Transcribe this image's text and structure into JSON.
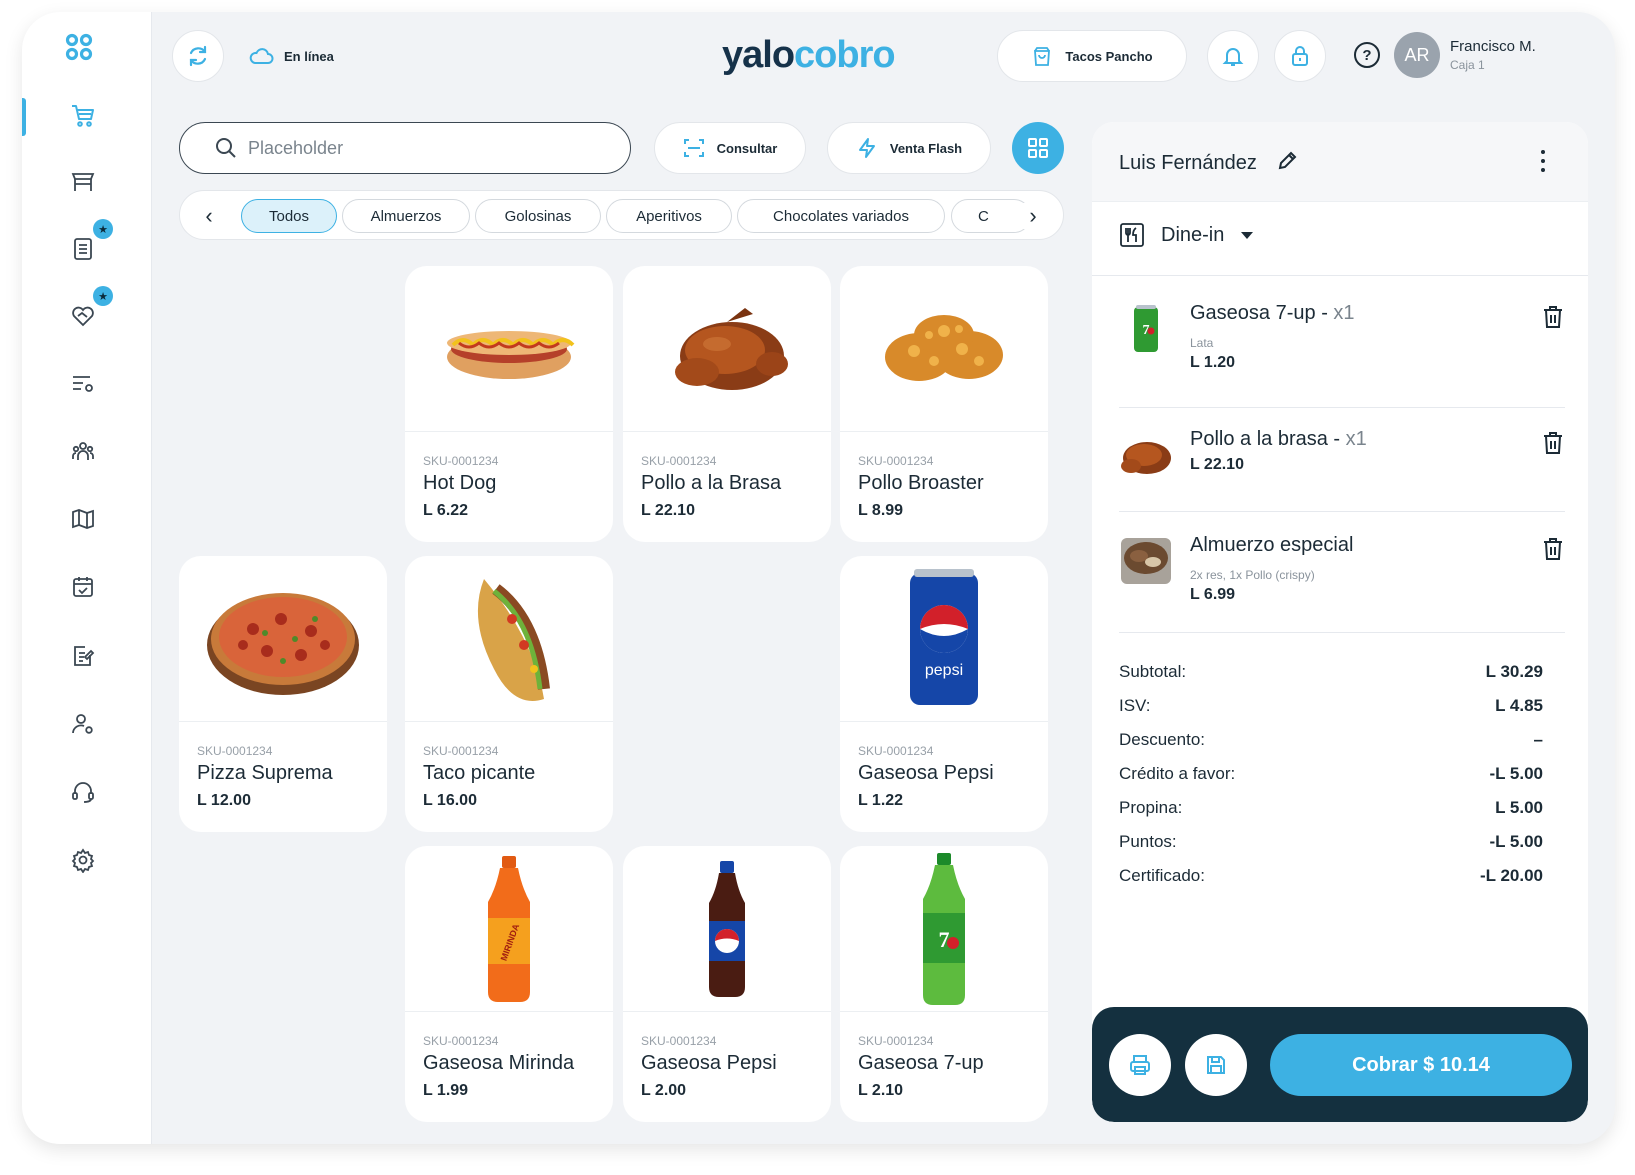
{
  "header": {
    "status_label": "En línea",
    "brand_part1": "yalo",
    "brand_part2": "cobro",
    "store_name": "Tacos Pancho",
    "help_symbol": "?",
    "user_initials": "AR",
    "user_name": "Francisco M.",
    "user_role": "Caja 1"
  },
  "search": {
    "placeholder": "Placeholder",
    "value": ""
  },
  "actions": {
    "consult_label": "Consultar",
    "flash_label": "Venta Flash"
  },
  "categories": [
    "Todos",
    "Almuerzos",
    "Golosinas",
    "Aperitivos",
    "Chocolates variados",
    "C"
  ],
  "active_category": "Todos",
  "products": [
    {
      "sku": "SKU-0001234",
      "name": "Hot Dog",
      "price": "L 6.22",
      "icon": "hotdog-image"
    },
    {
      "sku": "SKU-0001234",
      "name": "Pollo a la Brasa",
      "price": "L 22.10",
      "icon": "roast-chicken-image"
    },
    {
      "sku": "SKU-0001234",
      "name": "Pollo Broaster",
      "price": "L 8.99",
      "icon": "fried-chicken-image"
    },
    {
      "sku": "SKU-0001234",
      "name": "Pizza Suprema",
      "price": "L 12.00",
      "icon": "pizza-image"
    },
    {
      "sku": "SKU-0001234",
      "name": "Taco picante",
      "price": "L 16.00",
      "icon": "taco-image"
    },
    {
      "sku": "SKU-0001234",
      "name": "Gaseosa Pepsi",
      "price": "L 1.22",
      "icon": "pepsi-can-image"
    },
    {
      "sku": "SKU-0001234",
      "name": "Gaseosa Mirinda",
      "price": "L 1.99",
      "icon": "mirinda-bottle-image"
    },
    {
      "sku": "SKU-0001234",
      "name": "Gaseosa Pepsi",
      "price": "L 2.00",
      "icon": "pepsi-bottle-image"
    },
    {
      "sku": "SKU-0001234",
      "name": "Gaseosa 7-up",
      "price": "L 2.10",
      "icon": "7up-bottle-image"
    }
  ],
  "order": {
    "customer": "Luis Fernández",
    "service_type": "Dine-in",
    "items": [
      {
        "name": "Gaseosa 7-up -",
        "qty": "x1",
        "detail": "Lata",
        "price": "L 1.20"
      },
      {
        "name": "Pollo a la brasa -",
        "qty": "x1",
        "detail": "",
        "price": "L 22.10"
      },
      {
        "name": "Almuerzo especial",
        "qty": "",
        "detail": "2x res, 1x Pollo (crispy)",
        "price": "L 6.99"
      }
    ],
    "totals": [
      {
        "label": "Subtotal:",
        "value": "L 30.29"
      },
      {
        "label": "ISV:",
        "value": "L 4.85"
      },
      {
        "label": "Descuento:",
        "value": "–"
      },
      {
        "label": "Crédito a favor:",
        "value": "-L 5.00"
      },
      {
        "label": "Propina:",
        "value": "L 5.00"
      },
      {
        "label": "Puntos:",
        "value": "-L 5.00"
      },
      {
        "label": "Certificado:",
        "value": "-L 20.00"
      }
    ],
    "charge_label": "Cobrar $ 10.14"
  },
  "colors": {
    "accent": "#3db1e3",
    "dark": "#14303f",
    "text": "#1c2b36"
  }
}
